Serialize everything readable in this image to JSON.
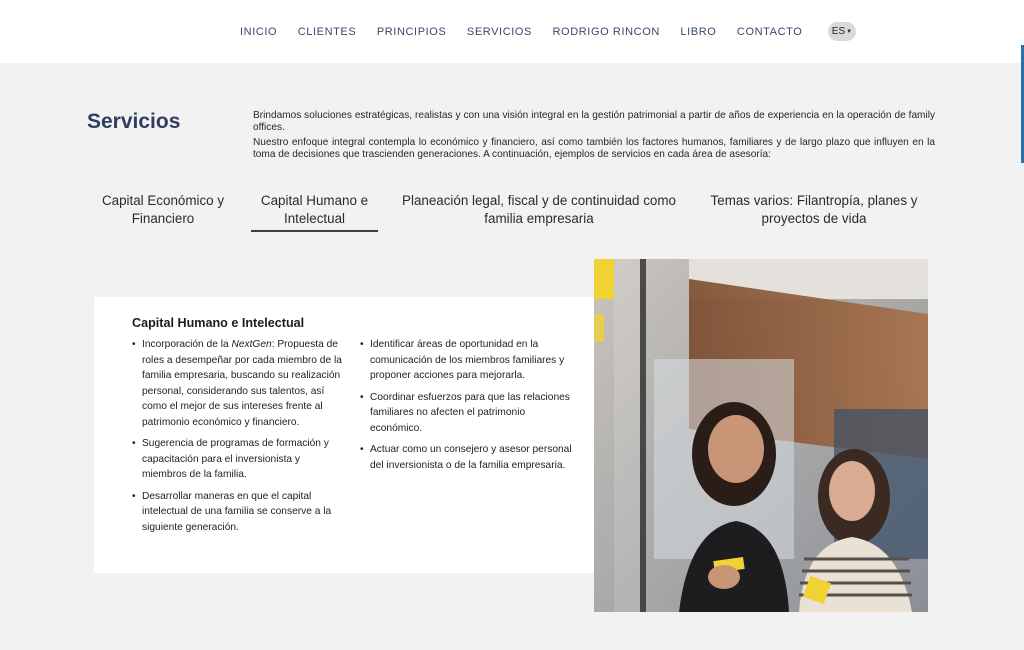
{
  "nav": {
    "items": [
      "INICIO",
      "CLIENTES",
      "PRINCIPIOS",
      "SERVICIOS",
      "RODRIGO RINCON",
      "LIBRO",
      "CONTACTO"
    ],
    "lang": "ES",
    "lang_icon": "chevron-down-icon"
  },
  "page": {
    "title": "Servicios",
    "intro": [
      "Brindamos soluciones estratégicas, realistas y con una visión integral en la gestión patrimonial a partir de años de experiencia en la operación de family offices.",
      "Nuestro enfoque integral contempla lo económico y financiero, así como también los factores humanos, familiares y de largo plazo que influyen en la toma de decisiones que trascienden generaciones. A continuación, ejemplos de servicios en cada área de asesoría:"
    ]
  },
  "tabs": [
    {
      "line1": "Capital Económico y",
      "line2": "Financiero"
    },
    {
      "line1": "Capital Humano e",
      "line2": "Intelectual"
    },
    {
      "line1": "Planeación legal, fiscal y de continuidad como",
      "line2": "familia empresaria"
    },
    {
      "line1": "Temas varios: Filantropía, planes y",
      "line2": "proyectos de vida"
    }
  ],
  "active_tab": 1,
  "card": {
    "title": "Capital Humano e Intelectual",
    "left_items": [
      {
        "prefix": "Incorporación de la ",
        "em": "NextGen",
        "text": ": Propuesta de roles a desempeñar por cada miembro de la familia empresaria, buscando su realización personal, considerando sus talentos, así como el mejor de sus intereses frente al patrimonio económico y financiero."
      },
      {
        "text": "Sugerencia de programas de formación y capacitación para el inversionista y miembros de la familia."
      },
      {
        "text": "Desarrollar maneras en que el capital intelectual de una familia se conserve a la siguiente generación."
      }
    ],
    "right_items": [
      {
        "text": "Identificar áreas de oportunidad en la comunicación de los miembros familiares y proponer acciones para mejorarla."
      },
      {
        "text": "Coordinar esfuerzos para que las relaciones familiares no afecten el patrimonio económico."
      },
      {
        "text": " Actuar como un consejero y asesor personal del inversionista o de la familia empresaria."
      }
    ]
  },
  "colors": {
    "nav_text": "#3a4868",
    "title": "#2f3e60",
    "background": "#f2f2f2",
    "card": "#ffffff",
    "accent": "#2d6fa6"
  }
}
